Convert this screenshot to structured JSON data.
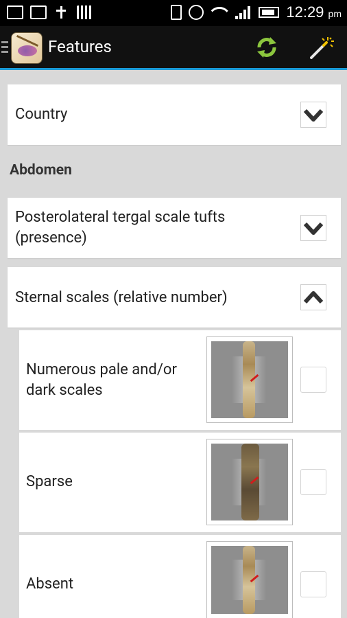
{
  "status_bar": {
    "time": "12:29",
    "ampm": "pm"
  },
  "action_bar": {
    "title": "Features",
    "refresh_icon": "refresh-icon",
    "wand_icon": "magic-wand-icon",
    "accent_color": "#1b9bd7",
    "refresh_color": "#8cc63e"
  },
  "features": {
    "country": {
      "label": "Country",
      "state": "collapsed"
    },
    "section": "Abdomen",
    "tergal": {
      "label_line1": "Posterolateral tergal scale tufts",
      "label_line2": "(presence)",
      "state": "collapsed"
    },
    "sternal": {
      "label": "Sternal scales (relative number)",
      "state": "expanded"
    }
  },
  "options": [
    {
      "label_line1": "Numerous pale and/or",
      "label_line2": "dark scales",
      "checked": false
    },
    {
      "label_line1": "Sparse",
      "label_line2": "",
      "checked": false
    },
    {
      "label_line1": "Absent",
      "label_line2": "",
      "checked": false
    }
  ]
}
